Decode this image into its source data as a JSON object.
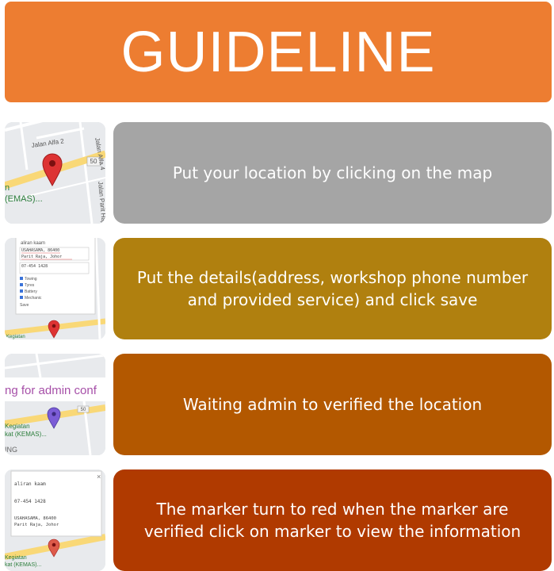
{
  "header": {
    "title": "GUIDELINE",
    "color": "#ed7d31"
  },
  "steps": [
    {
      "text": "Put your location by clicking on the map",
      "color": "#a5a5a5",
      "thumb": {
        "label_top": "Jalan Alfa 2",
        "label_road": "Jalan Alfa 4",
        "label_side": "Jalan Parit Haji",
        "road_no": "50",
        "label_place": "n\n(EMAS)...",
        "marker": "red-pin-icon"
      }
    },
    {
      "text": "Put the details(address, workshop phone number and provided service) and click save",
      "color": "#b0800f",
      "thumb": {
        "name": "aliran kaam",
        "address_1": "USAHASAMA, 86400",
        "address_2": "Parit Raja, Johor",
        "phone": "07-454 1428",
        "options": [
          "Towing",
          "Tyres",
          "Battery",
          "Mechanic"
        ],
        "save": "Save",
        "label_place": "Kegiatan",
        "marker": "red-pin-icon"
      }
    },
    {
      "text": "Waiting admin to verified the location",
      "color": "#b35800",
      "thumb": {
        "banner": "ng for admin conf",
        "label_place_1": "Kegiatan",
        "label_place_2": "kat (KEMAS)...",
        "label_bottom": "ING",
        "road_no": "50",
        "marker": "purple-pin-icon"
      }
    },
    {
      "text": "The marker turn to red when the marker are verified click on marker to view the information",
      "color": "#b03a00",
      "thumb": {
        "name": "aliran kaam",
        "phone": "07-454 1428",
        "address_1": "USAHASAMA, 86400",
        "address_2": "Parit Raja, Johor",
        "close": "×",
        "label_place_1": "Kegiatan",
        "label_place_2": "kat (KEMAS)...",
        "marker": "red-pin-icon"
      }
    }
  ]
}
